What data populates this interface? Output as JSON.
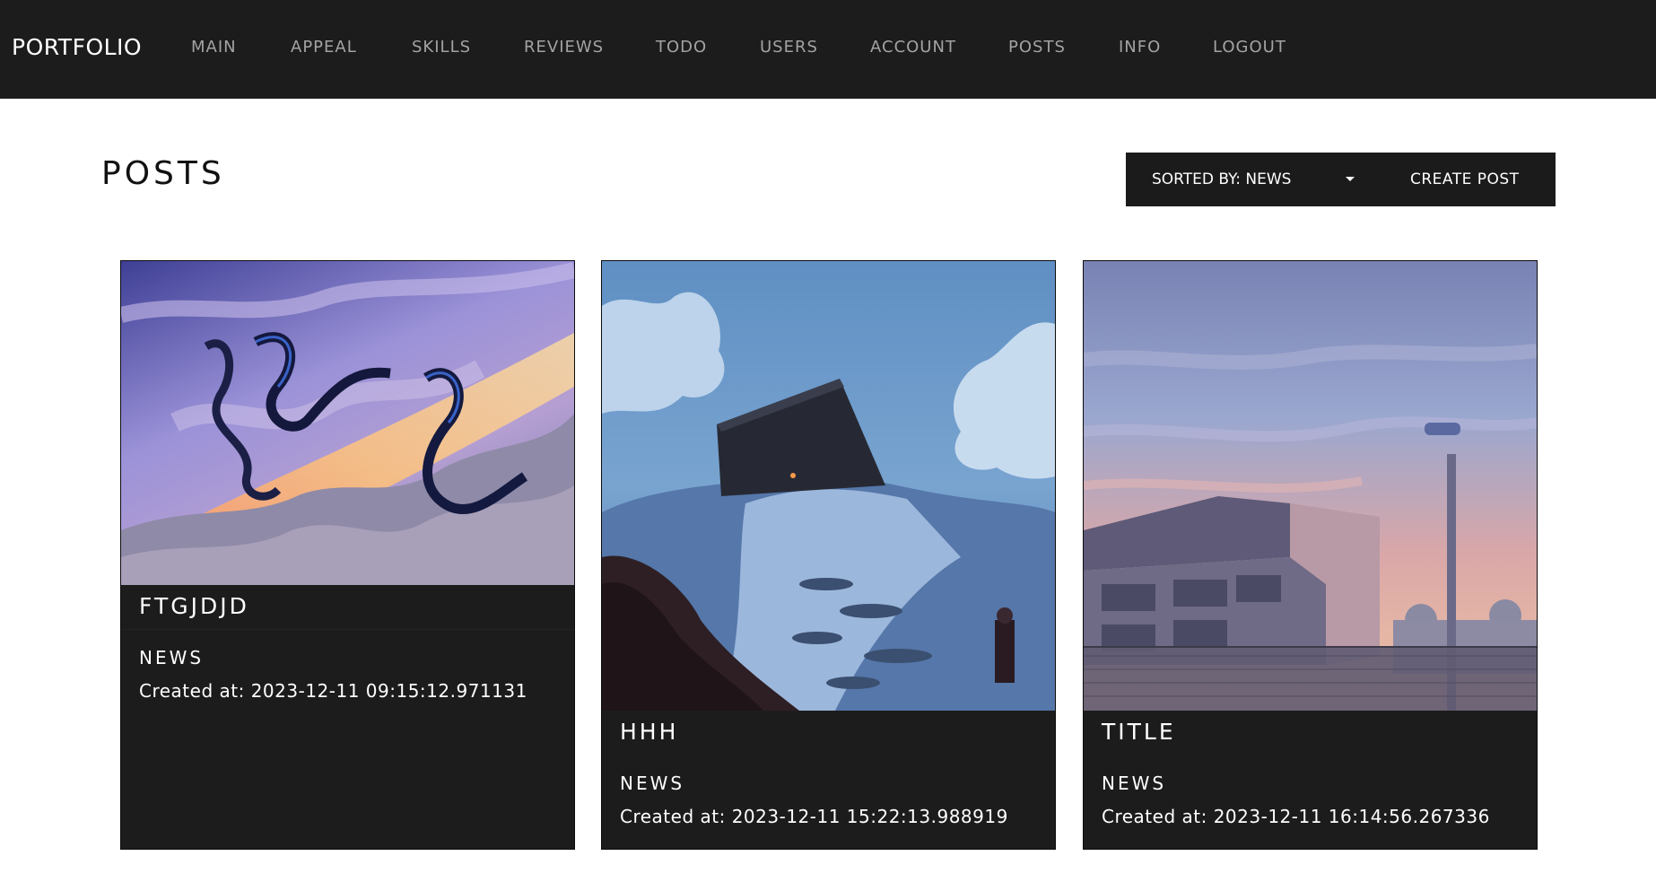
{
  "nav": {
    "brand": "PORTFOLIO",
    "items": [
      {
        "label": "MAIN"
      },
      {
        "label": "APPEAL"
      },
      {
        "label": "SKILLS"
      },
      {
        "label": "REVIEWS"
      },
      {
        "label": "TODO"
      },
      {
        "label": "USERS"
      },
      {
        "label": "ACCOUNT"
      },
      {
        "label": "POSTS"
      },
      {
        "label": "INFO"
      },
      {
        "label": "LOGOUT"
      }
    ]
  },
  "page": {
    "title": "POSTS"
  },
  "toolbar": {
    "sort_label": "SORTED BY: NEWS",
    "create_label": "CREATE POST"
  },
  "posts": [
    {
      "title": "FTGJDJD",
      "category": "NEWS",
      "created": "Created at: 2023-12-11 09:15:12.971131"
    },
    {
      "title": "HHH",
      "category": "NEWS",
      "created": "Created at: 2023-12-11 15:22:13.988919"
    },
    {
      "title": "TITLE",
      "category": "NEWS",
      "created": "Created at: 2023-12-11 16:14:56.267336"
    }
  ],
  "colors": {
    "navbar": "#1c1c1c",
    "card": "#1c1c1c",
    "nav_text": "#a3a3a3"
  }
}
